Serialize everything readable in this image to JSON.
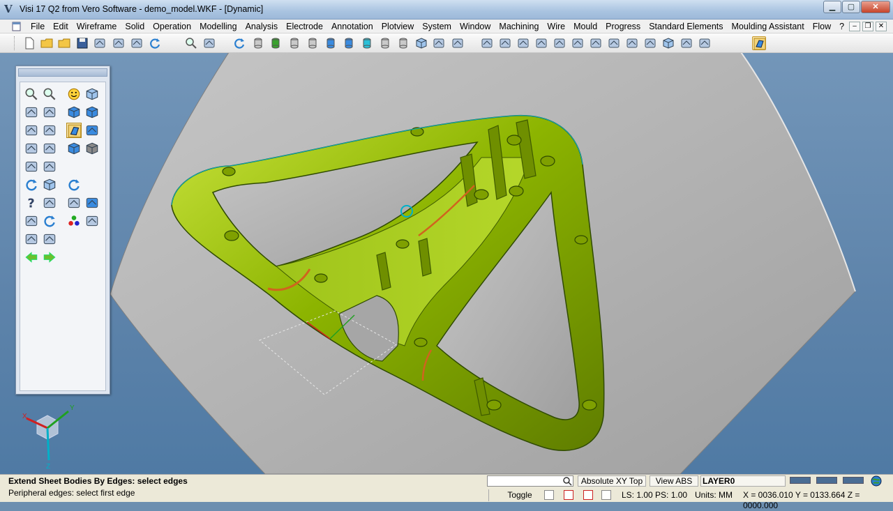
{
  "window": {
    "title": "Visi 17 Q2 from Vero Software - demo_model.WKF - [Dynamic]",
    "minimize_glyph": "▁",
    "maximize_glyph": "▢",
    "close_glyph": "✕"
  },
  "menu": {
    "items": [
      "File",
      "Edit",
      "Wireframe",
      "Solid",
      "Operation",
      "Modelling",
      "Analysis",
      "Electrode",
      "Annotation",
      "Plotview",
      "System",
      "Window",
      "Machining",
      "Wire",
      "Mould",
      "Progress",
      "Standard Elements",
      "Moulding Assistant",
      "Flow",
      "?"
    ],
    "mdi_min": "–",
    "mdi_restore": "❐",
    "mdi_close": "✕"
  },
  "toolbar": {
    "icons": [
      "new-file-icon",
      "open-file-icon",
      "open-folder-icon",
      "save-icon",
      "print-icon",
      "export-icon",
      "import-icon",
      "refresh-icon",
      "zoom-icon",
      "panel-icon",
      "rotate-icon",
      "cylinder-icon",
      "cylinder-green-icon",
      "cylinder-icon",
      "cylinder-icon",
      "cylinder-blue-icon",
      "cylinder-blue-icon",
      "cylinder-cyan-icon",
      "cylinder-icon",
      "cylinder-striped-icon",
      "cube-icon",
      "cut-icon",
      "grid-icon",
      "plane-icon",
      "revolve-icon",
      "sweep-icon",
      "loft-icon",
      "mesh-icon",
      "surface-icon",
      "pipe-icon",
      "curve-icon",
      "offset-icon",
      "shell-icon",
      "solid-cube-icon",
      "extend-icon",
      "trim-icon",
      "extend-sheet-icon"
    ]
  },
  "palette": {
    "icons": [
      "zoom-window-icon",
      "measure-icon",
      "smiley-icon",
      "wire-cube-icon",
      "frame-icon",
      "knife-icon",
      "cube-blue-icon",
      "cube-blue-icon",
      "scale-icon",
      "folded-sheet-icon",
      "extend-sheet-active-icon",
      "sheet-blue-icon",
      "vector-icon",
      "eraser-icon",
      "cube-blue-icon",
      "cube-grey-icon",
      "layers-icon",
      "stack-icon",
      "rotate-arrows-icon",
      "solid-cube-icon",
      "curved-arrow-icon",
      "help-icon",
      "bracket-icon",
      "cloud-icon",
      "arrows-blue-icon",
      "trash-icon",
      "undo-arrows-icon",
      "colour-dots-icon",
      "pencil-icon",
      "hammer-icon",
      "image-icon",
      "arrow-left-icon",
      "arrow-right-icon"
    ]
  },
  "axis": {
    "x": "X",
    "y": "Y",
    "z": "Z"
  },
  "status": {
    "line1": "Extend Sheet Bodies By Edges: select edges",
    "line2": "Peripheral edges: select first edge",
    "search_value": "",
    "view_orient": "Absolute XY Top",
    "view_abs": "View ABS",
    "layer": "LAYER0",
    "toggle": "Toggle",
    "ls_ps": "LS: 1.00 PS: 1.00",
    "units": "Units: MM",
    "coords": "X = 0036.010 Y = 0133.664 Z = 0000.000"
  },
  "colors": {
    "part": "#8cb400",
    "part_dark": "#4f6a00",
    "part_light": "#c3e03a",
    "sheet": "#b4b4b4",
    "sheet_light": "#d4d4d4",
    "edge_highlight": "#00b0c8",
    "edge_orange": "#d0641e"
  }
}
